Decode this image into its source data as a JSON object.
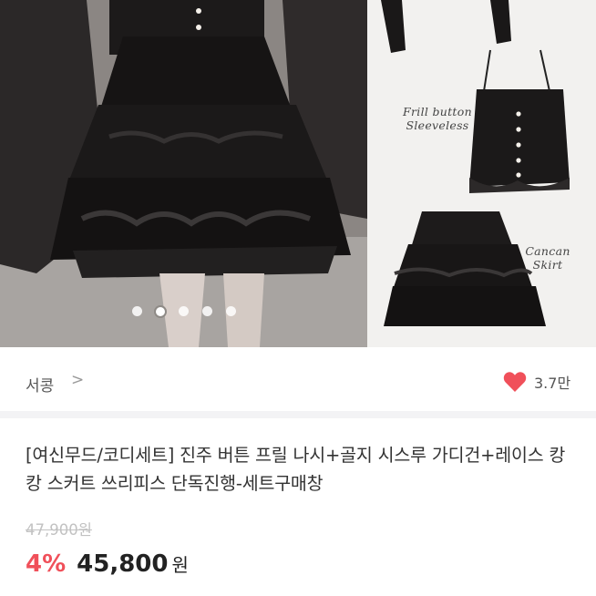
{
  "gallery": {
    "image_count": 5,
    "active_index": 2,
    "labels": {
      "frill_line1": "Frill button",
      "frill_line2": "Sleeveless",
      "cancan_line1": "Cancan",
      "cancan_line2": "Skirt"
    }
  },
  "seller": {
    "name": "서콩",
    "chevron": ">"
  },
  "likes": {
    "count": "3.7만",
    "heart_color": "#f0505a"
  },
  "product": {
    "title": "[여신무드/코디세트] 진주 버튼 프릴 나시+골지 시스루 가디건+레이스 캉캉 스커트 쓰리피스 단독진행-세트구매창",
    "original_price": "47,900원",
    "discount": "4%",
    "price": "45,800",
    "currency": "원"
  },
  "colors": {
    "accent": "#f0505a",
    "divider": "#f3f3f5"
  }
}
